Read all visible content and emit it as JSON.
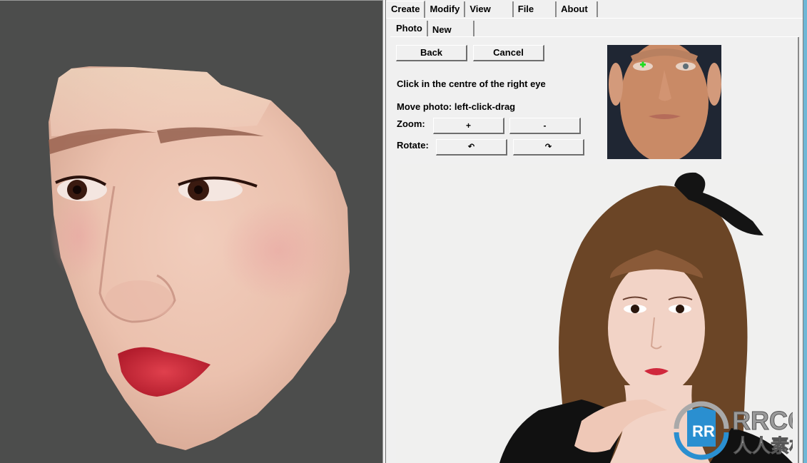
{
  "tabs": [
    {
      "label": "Create",
      "active": true
    },
    {
      "label": "Modify",
      "active": false
    },
    {
      "label": "View",
      "active": false
    },
    {
      "label": "File",
      "active": false
    },
    {
      "label": "About",
      "active": false
    }
  ],
  "subtabs": [
    {
      "label": "Photo",
      "active": true
    },
    {
      "label": "New",
      "active": false
    }
  ],
  "buttons": {
    "back": "Back",
    "cancel": "Cancel",
    "zoom_in": "+",
    "zoom_out": "-",
    "rotate_left": "↶",
    "rotate_right": "↷"
  },
  "instructions": {
    "step": "Click in the centre of the right eye",
    "move": "Move photo: left-click-drag",
    "zoom_label": "Zoom:",
    "rotate_label": "Rotate:"
  },
  "reference_photo": {
    "description": "reference face with green marker on right eye",
    "marker_color": "#22dd22"
  },
  "watermark": {
    "brand": "RRCG",
    "subtitle": "人人素材",
    "logo_letters": "RR",
    "color": "#2a8fd0"
  },
  "colors": {
    "viewport_bg": "#4c4d4c",
    "panel_bg": "#f0f0f0",
    "accent_edge": "#6fb7d6"
  }
}
